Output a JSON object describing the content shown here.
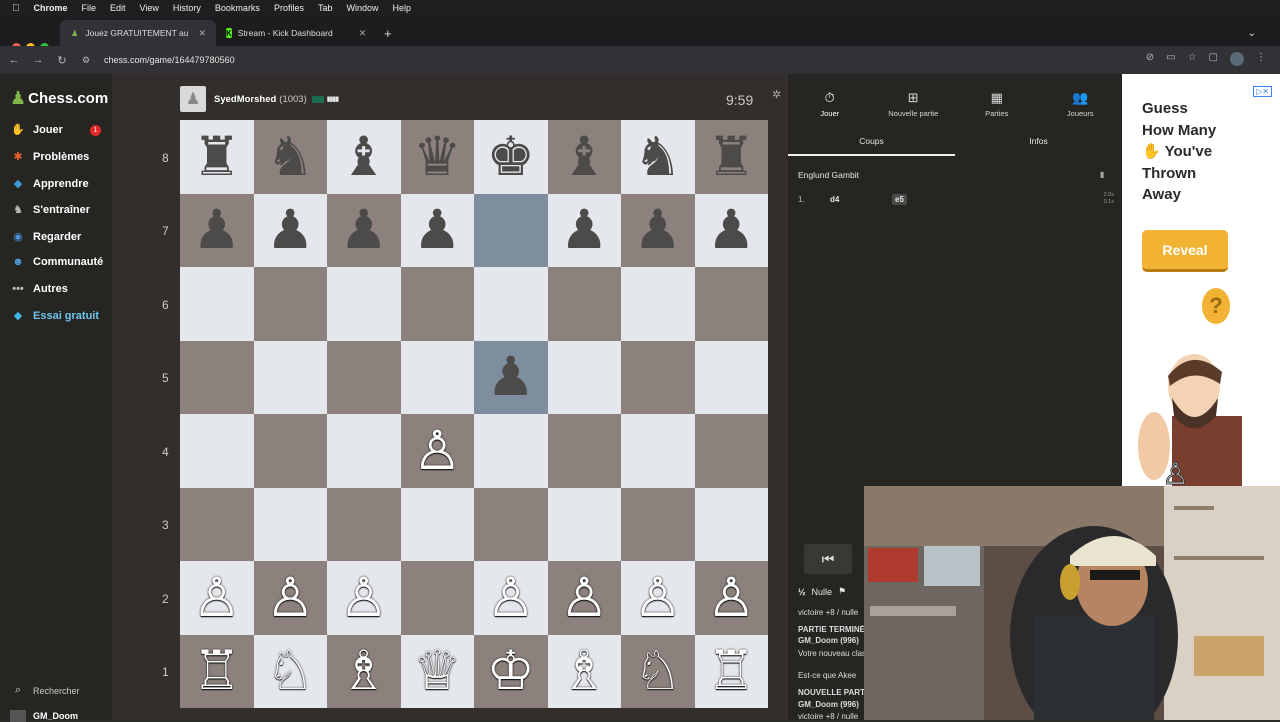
{
  "menubar": {
    "app": "Chrome",
    "items": [
      "File",
      "Edit",
      "View",
      "History",
      "Bookmarks",
      "Profiles",
      "Tab",
      "Window",
      "Help"
    ]
  },
  "tabs": [
    {
      "title": "Jouez GRATUITEMENT aux é",
      "active": true
    },
    {
      "title": "Stream - Kick Dashboard",
      "active": false
    }
  ],
  "toolbar": {
    "url": "chess.com/game/164479780560"
  },
  "sidebar": {
    "logo": "Chess.com",
    "items": [
      {
        "label": "Jouer",
        "icon": "hand-icon",
        "color": "#f39c4b",
        "badge": "1"
      },
      {
        "label": "Problèmes",
        "icon": "puzzle-icon",
        "color": "#e86431"
      },
      {
        "label": "Apprendre",
        "icon": "learn-icon",
        "color": "#3b9bdc"
      },
      {
        "label": "S'entraîner",
        "icon": "train-icon",
        "color": "#bbbbbb"
      },
      {
        "label": "Regarder",
        "icon": "binoculars-icon",
        "color": "#4c8ed9"
      },
      {
        "label": "Communauté",
        "icon": "community-icon",
        "color": "#4f9fdc"
      },
      {
        "label": "Autres",
        "icon": "more-icon",
        "color": "#bbbbbb"
      },
      {
        "label": "Essai gratuit",
        "icon": "diamond-icon",
        "color": "#3fb7e8"
      }
    ],
    "search": "Rechercher",
    "user": "GM_Doom"
  },
  "game": {
    "opponent": "SyedMorshed",
    "rating": "(1003)",
    "clock": "9:59"
  },
  "board": {
    "ranks": [
      "8",
      "7",
      "6",
      "5",
      "4",
      "3",
      "2",
      "1"
    ],
    "rows": [
      [
        "♜",
        "♞",
        "♝",
        "♛",
        "♚",
        "♝",
        "♞",
        "♜"
      ],
      [
        "♟",
        "♟",
        "♟",
        "♟",
        "",
        "♟",
        "♟",
        "♟"
      ],
      [
        "",
        "",
        "",
        "",
        "",
        "",
        "",
        ""
      ],
      [
        "",
        "",
        "",
        "",
        "♟",
        "",
        "",
        ""
      ],
      [
        "",
        "",
        "",
        "♙",
        "",
        "",
        "",
        ""
      ],
      [
        "",
        "",
        "",
        "",
        "",
        "",
        "",
        ""
      ],
      [
        "♙",
        "♙",
        "♙",
        "",
        "♙",
        "♙",
        "♙",
        "♙"
      ],
      [
        "♖",
        "♘",
        "♗",
        "♕",
        "♔",
        "♗",
        "♘",
        "♖"
      ]
    ]
  },
  "panel": {
    "tabs": [
      {
        "label": "Jouer",
        "icon": "clock-icon"
      },
      {
        "label": "Nouvelle partie",
        "icon": "plus-icon"
      },
      {
        "label": "Parties",
        "icon": "grid-icon"
      },
      {
        "label": "Joueurs",
        "icon": "players-icon"
      }
    ],
    "subtabs": [
      "Coups",
      "Infos"
    ],
    "opening": "Englund Gambit",
    "moves": [
      {
        "num": "1.",
        "white": "d4",
        "black": "e5",
        "t1": "2.0s",
        "t2": "0.1s"
      }
    ],
    "draw": "Nulle",
    "chat": [
      {
        "text": "victoire +8 / nulle"
      },
      {
        "bold": "PARTIE TERMINÉE"
      },
      {
        "bold": "GM_Doom (996)"
      },
      {
        "text": "Votre nouveau classement"
      },
      {
        "text": "Est-ce que Akee"
      },
      {
        "bold": "NOUVELLE PARTIE"
      },
      {
        "bold": "GM_Doom (996)"
      },
      {
        "text": "victoire +8 / nulle"
      }
    ]
  },
  "ad": {
    "lines": [
      "Guess",
      "How Many",
      "✋ You've",
      "Thrown",
      "Away"
    ],
    "button": "Reveal",
    "qmark": "?"
  }
}
